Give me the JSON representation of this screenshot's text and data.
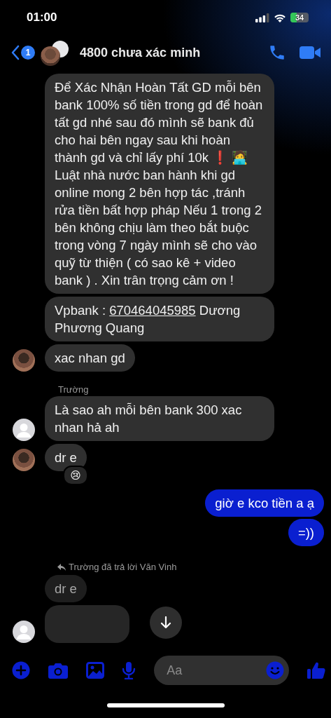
{
  "status_bar": {
    "time": "01:00",
    "battery": "34"
  },
  "header": {
    "unread": "1",
    "title": "4800 chưa xác minh"
  },
  "thread": [
    {
      "kind": "incoming",
      "text": "Để Xác Nhận Hoàn Tất GD mỗi bên bank 100% số tiền trong gd để hoàn tất gd nhé sau đó mình sẽ bank đủ cho hai bên ngay sau khi hoàn thành gd và chỉ lấy phí 10k ❗ 🧑‍💻 Luật nhà nước ban hành khi gd online mong 2 bên hợp tác ,tránh rửa tiền bất hợp pháp Nếu 1 trong 2 bên không chịu làm theo bắt buộc trong vòng 7 ngày mình sẽ cho vào quỹ từ thiện ( có sao kê + video bank ) . Xin trân trọng cảm ơn !"
    },
    {
      "kind": "incoming",
      "text": "Vpbank : ",
      "link": "670464045985",
      "text_after": "  Dương Phương Quang"
    },
    {
      "kind": "incoming",
      "text": "xac nhan gd",
      "avatar": {
        "kind": "photo"
      }
    },
    {
      "kind": "sender",
      "text": "Trường"
    },
    {
      "kind": "incoming",
      "text": "Là sao ah mỗi bên bank 300 xac nhan hả ah",
      "avatar": {
        "kind": "placeholder"
      }
    },
    {
      "kind": "incoming",
      "text": "dr e",
      "avatar": {
        "kind": "photo"
      },
      "reaction": "😢"
    },
    {
      "kind": "outgoing",
      "text": "giờ e kco tiền a ạ"
    },
    {
      "kind": "outgoing",
      "text": "=))"
    },
    {
      "kind": "reply_note",
      "text": "Trường đã trả lời Văn Vinh"
    },
    {
      "kind": "quoted",
      "text": "dr e"
    },
    {
      "kind": "partial",
      "avatar": {
        "kind": "placeholder"
      }
    }
  ],
  "composer": {
    "placeholder": "Aa"
  }
}
